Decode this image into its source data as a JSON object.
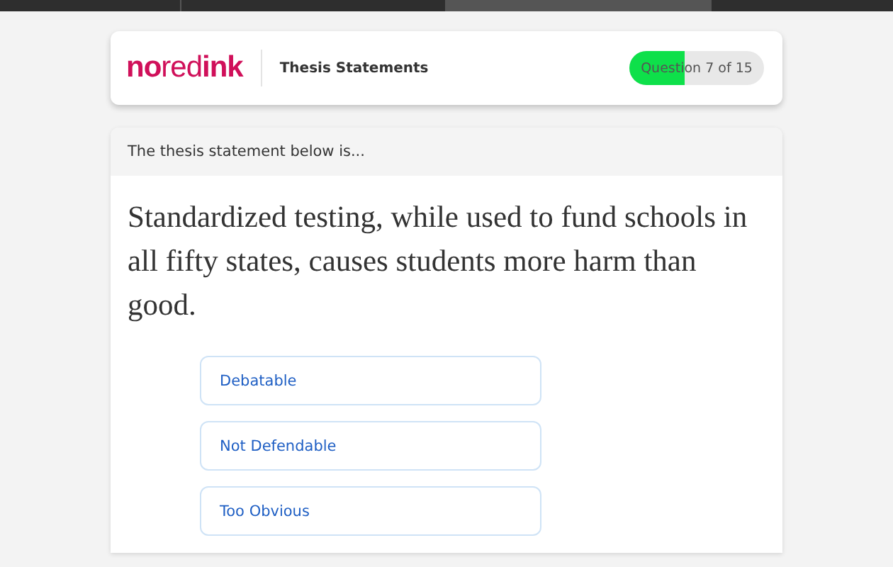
{
  "header": {
    "logo": "**no**red**ink**",
    "title": "Thesis Statements",
    "progress": {
      "label": "Question 7 of 15",
      "level": 0.41
    }
  },
  "question": {
    "prompt": "The thesis statement below is...",
    "statement": "Standardized testing, while used to fund schools in all fifty states, causes students more harm than good.",
    "options": [
      {
        "label": "Debatable",
        "selected": false
      },
      {
        "label": "Not Defendable",
        "selected": false
      },
      {
        "label": "Too Obvious",
        "selected": false
      }
    ]
  }
}
